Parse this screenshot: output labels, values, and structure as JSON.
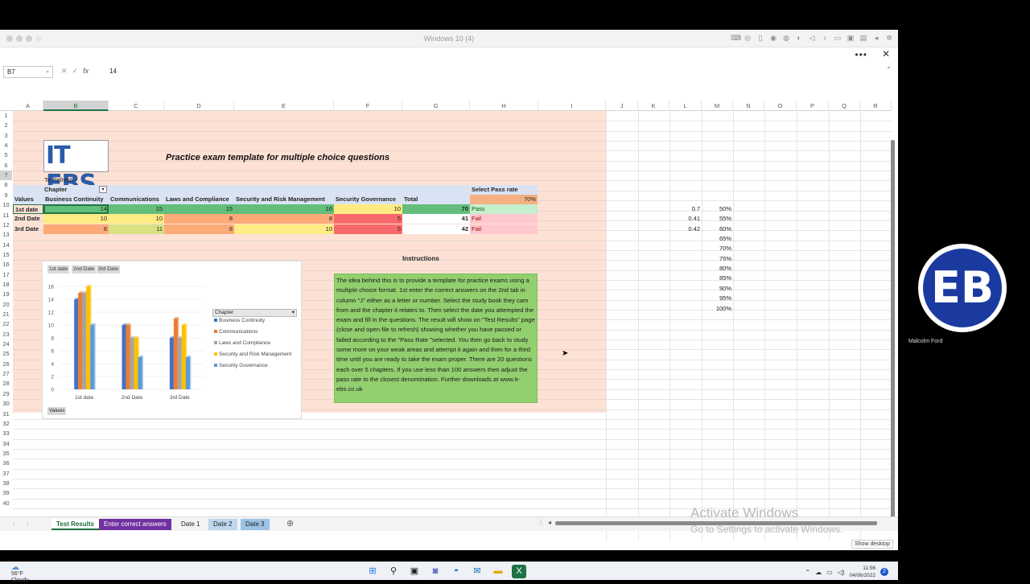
{
  "vm": {
    "title": "Windows 10 (4)"
  },
  "formula_bar": {
    "name_box": "B7",
    "value": "14",
    "fx": "fx"
  },
  "columns": [
    "A",
    "B",
    "C",
    "D",
    "E",
    "F",
    "G",
    "H",
    "I",
    "J",
    "K",
    "L",
    "M",
    "N",
    "O",
    "P",
    "Q",
    "R"
  ],
  "rows": [
    "1",
    "2",
    "3",
    "4",
    "5",
    "6",
    "7",
    "8",
    "9",
    "10",
    "11",
    "12",
    "13",
    "14",
    "15",
    "16",
    "17",
    "18",
    "19",
    "20",
    "21",
    "22",
    "23",
    "24",
    "25",
    "26",
    "27",
    "28",
    "29",
    "30",
    "31",
    "32",
    "33",
    "34",
    "35",
    "36",
    "37",
    "38",
    "39",
    "40"
  ],
  "sheet": {
    "logo_text": "IT EBS",
    "title": "Practice exam template for multiple choice questions",
    "refresh": "To Refresh",
    "chapter_label": "Chapter",
    "values_label": "Values",
    "select_pass_rate": "Select Pass rate",
    "pass_rate": "70%",
    "headers": [
      "Business Continuity",
      "Communications",
      "Laws and Compliance",
      "Security and Risk Management",
      "Security Governance",
      "Total"
    ],
    "data_rows": [
      {
        "label": "1st date",
        "vals": [
          "14",
          "15",
          "15",
          "16",
          "10"
        ],
        "total": "70",
        "result": "Pass"
      },
      {
        "label": "2nd Date",
        "vals": [
          "10",
          "10",
          "8",
          "8",
          "5"
        ],
        "total": "41",
        "result": "Fail"
      },
      {
        "label": "3rd Date",
        "vals": [
          "8",
          "11",
          "8",
          "10",
          "5"
        ],
        "total": "42",
        "result": "Fail"
      }
    ],
    "side_L": [
      "0.7",
      "0.41",
      "0.42"
    ],
    "side_M": [
      "50%",
      "55%",
      "60%",
      "65%",
      "70%",
      "75%",
      "80%",
      "85%",
      "90%",
      "95%",
      "100%"
    ],
    "instructions_head": "Instructions",
    "instructions": "The idea behind this is to provide a template for practice exams using a multiple choice format. 1st enter the correct answers on the 2nd tab in column \"J\" either as a letter or number. Select the study book they cam from and the chapter it relates to. Then select the date you attempted the exam and fill in the questions. The result will show on \"Test Results\" page (close and open file to refresh) showing whether you have passed or failed according to the \"Pass Rate \"selected.  You then go back to study some more on your weak areas and attempt it again and then for a third time until you are ready to take the exam proper.  There are 20 questions each over 5 chapters.  If you use less than 100 answers then adjust the pass rate to the closest denomination. Further downloads at www.it-ebs.co.uk"
  },
  "chart_data": {
    "type": "bar",
    "categories": [
      "1st date",
      "2nd Date",
      "3rd Date"
    ],
    "series": [
      {
        "name": "Business Continuity",
        "values": [
          14,
          10,
          8
        ],
        "color": "#4472c4"
      },
      {
        "name": "Communications",
        "values": [
          15,
          10,
          11
        ],
        "color": "#ed7d31"
      },
      {
        "name": "Laws and Compliance",
        "values": [
          15,
          8,
          8
        ],
        "color": "#a5a5a5"
      },
      {
        "name": "Security and Risk Management",
        "values": [
          16,
          8,
          10
        ],
        "color": "#ffc000"
      },
      {
        "name": "Security Governance",
        "values": [
          10,
          5,
          5
        ],
        "color": "#5b9bd5"
      }
    ],
    "ylim": [
      0,
      16
    ],
    "yticks": [
      "0",
      "2",
      "4",
      "6",
      "8",
      "10",
      "12",
      "14",
      "16"
    ],
    "legend_title": "Chapter",
    "filter_buttons": [
      "1st date",
      "2nd Date",
      "3rd Date"
    ],
    "values_button": "Values"
  },
  "tabs": [
    "Test Results",
    "Enter correct answers",
    "Date 1",
    "Date 2",
    "Date 3"
  ],
  "watermark": {
    "line1": "Activate Windows",
    "line2": "Go to Settings to activate Windows."
  },
  "show_desktop": "Show desktop",
  "taskbar": {
    "temp": "56°F",
    "weather": "Cloudy",
    "time": "11:56",
    "date": "04/06/2022",
    "badge": "2"
  },
  "participant": {
    "name": "Malcolm Ford",
    "initials": "EB"
  }
}
